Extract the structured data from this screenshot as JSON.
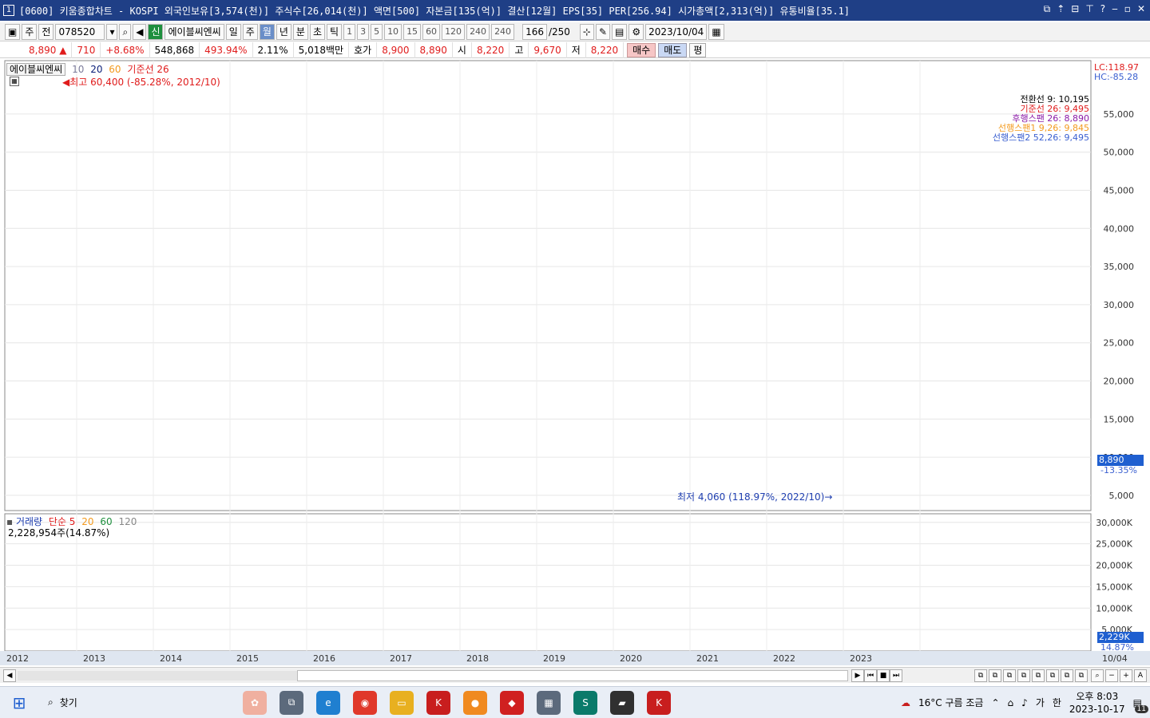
{
  "window": {
    "number": "1",
    "title": "[0600] 키움종합차트 - KOSPI 외국인보유[3,574(천)] 주식수[26,014(천)] 액면[500] 자본금[135(억)] 결산[12월] EPS[35] PER[256.94] 시가총액[2,313(억)] 유통비율[35.1]",
    "controls": [
      "⧉",
      "⇡",
      "⊟",
      "⊤",
      "?",
      "‒",
      "▫",
      "✕"
    ]
  },
  "toolbar": {
    "period_select": "주",
    "prev_label": "전",
    "code": "078520",
    "new_badge": "신",
    "stock_name": "에이블씨엔씨",
    "intervals": [
      "일",
      "주",
      "월",
      "년",
      "분",
      "초",
      "틱"
    ],
    "selected_interval": "월",
    "minute_options": [
      "1",
      "3",
      "5",
      "10",
      "15",
      "60",
      "120",
      "240",
      "240"
    ],
    "count": "166",
    "count_total": "/250",
    "date": "2023/10/04"
  },
  "quote": {
    "price": "8,890",
    "change_arrow": "▲",
    "change": "710",
    "change_pct": "+8.68%",
    "volume": "548,868",
    "volume_ratio": "493.94%",
    "turnover": "2.11%",
    "amount": "5,018백만",
    "ask_label": "호가",
    "ask1": "8,900",
    "ask2": "8,890",
    "open_label": "시",
    "open": "8,220",
    "high_label": "고",
    "high": "9,670",
    "low_label": "저",
    "low": "8,220",
    "buy": "매수",
    "sell": "매도",
    "eval": "평"
  },
  "price_panel": {
    "legend_name": "에이블씨엔씨",
    "ma_labels": [
      "10",
      "20",
      "60"
    ],
    "kijun_label": "기준선 26",
    "max_annotation": "최고 60,400 (-85.28%, 2012/10)",
    "min_annotation": "최저 4,060 (118.97%, 2022/10)",
    "lc": "LC:118.97",
    "hc": "HC:-85.28",
    "ichimoku": [
      {
        "label": "전환선 9: 10,195",
        "color": "#000000"
      },
      {
        "label": "기준선 26: 9,495",
        "color": "#e01c1c"
      },
      {
        "label": "후행스팬 26: 8,890",
        "color": "#8a1aa8"
      },
      {
        "label": "선행스팬1 9,26: 9,845",
        "color": "#f39a1e"
      },
      {
        "label": "선행스팬2 52,26: 9,495",
        "color": "#3a5fd0"
      }
    ],
    "current_price_tag": "8,890",
    "current_pct_tag": "-13.35%",
    "y_ticks": [
      "55,000",
      "50,000",
      "45,000",
      "40,000",
      "35,000",
      "30,000",
      "25,000",
      "20,000",
      "15,000",
      "10,000",
      "5,000"
    ]
  },
  "volume_panel": {
    "legend_title": "거래량",
    "legend_simple": "단순 5",
    "ma_labels": [
      "20",
      "60",
      "120"
    ],
    "current_volume": "2,228,954주(14.87%)",
    "current_tag": "2,229K",
    "current_pct_tag": "14.87%",
    "y_ticks": [
      "30,000K",
      "25,000K",
      "20,000K",
      "15,000K",
      "10,000K",
      "5,000K"
    ]
  },
  "x_ticks": [
    "2012",
    "2013",
    "2014",
    "2015",
    "2016",
    "2017",
    "2018",
    "2019",
    "2020",
    "2021",
    "2022",
    "2023"
  ],
  "x_end_label": "10/04",
  "taskbar": {
    "search_label": "찾기",
    "weather": "16°C  구름 조금",
    "ime_lang": "가",
    "ime_mode": "한",
    "time": "오후 8:03",
    "date": "2023-10-17",
    "notif_count": "11"
  },
  "colors": {
    "up": "#e01c1c",
    "down": "#1f5fd0",
    "ma10": "#7b7b9a",
    "ma20": "#0a1e78",
    "ma60": "#f39a1e",
    "kijun": "#e01c1c",
    "titlebar": "#1f3f86"
  },
  "chart_data": {
    "type": "candlestick",
    "price_ohlc_summary": {
      "high": 60400,
      "high_date": "2012/10",
      "low": 4060,
      "low_date": "2022/10",
      "last": 8890
    },
    "y_range": [
      3000,
      62000
    ],
    "volume_range_k": [
      0,
      32000
    ]
  }
}
